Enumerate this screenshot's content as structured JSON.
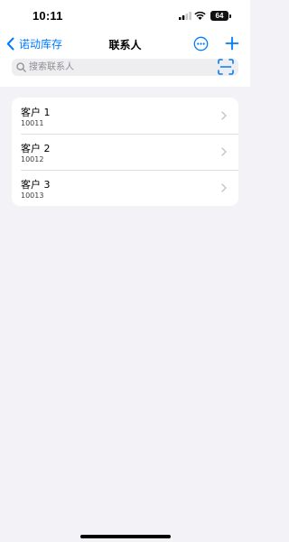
{
  "status_bar": {
    "time": "10:11",
    "battery": "64"
  },
  "nav": {
    "back_label": "诺动库存",
    "title": "联系人"
  },
  "search": {
    "placeholder": "搜索联系人"
  },
  "contacts": [
    {
      "name": "客户 1",
      "code": "10011"
    },
    {
      "name": "客户 2",
      "code": "10012"
    },
    {
      "name": "客户 3",
      "code": "10013"
    }
  ],
  "colors": {
    "accent": "#007aff",
    "background": "#f2f2f7",
    "card": "#ffffff",
    "search_field": "#eeeef0",
    "secondary_text": "#8e8e93",
    "chevron": "#c4c4c7"
  }
}
